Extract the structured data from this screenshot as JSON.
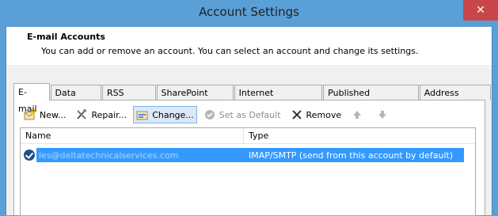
{
  "window": {
    "title": "Account Settings",
    "close_glyph": "✕"
  },
  "header": {
    "title": "E-mail Accounts",
    "description": "You can add or remove an account. You can select an account and change its settings."
  },
  "tabs": [
    {
      "label": "E-mail",
      "active": true
    },
    {
      "label": "Data Files",
      "active": false
    },
    {
      "label": "RSS Feeds",
      "active": false
    },
    {
      "label": "SharePoint Lists",
      "active": false
    },
    {
      "label": "Internet Calendars",
      "active": false
    },
    {
      "label": "Published Calendars",
      "active": false
    },
    {
      "label": "Address Books",
      "active": false
    }
  ],
  "toolbar": {
    "new_label": "New...",
    "repair_label": "Repair...",
    "change_label": "Change...",
    "set_default_label": "Set as Default",
    "remove_label": "Remove"
  },
  "grid": {
    "columns": {
      "name": "Name",
      "type": "Type"
    },
    "rows": [
      {
        "name": "les@deltatechnicalservices.com",
        "type": "IMAP/SMTP (send from this account by default)"
      }
    ]
  },
  "colors": {
    "titlebar": "#5a9fd6",
    "close": "#c9474a",
    "selection": "#3399ff"
  }
}
